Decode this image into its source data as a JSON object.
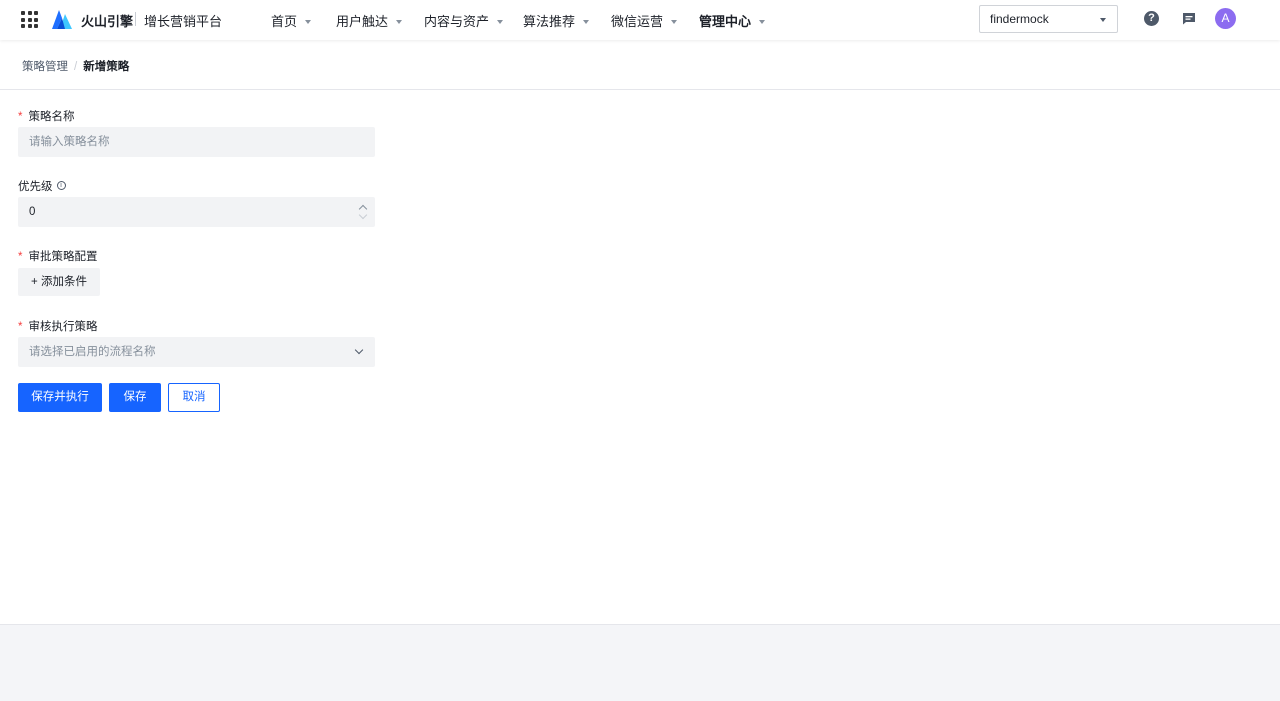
{
  "header": {
    "brand": "火山引擎",
    "platform": "增长营销平台",
    "nav": [
      {
        "label": "首页"
      },
      {
        "label": "用户触达"
      },
      {
        "label": "内容与资产"
      },
      {
        "label": "算法推荐"
      },
      {
        "label": "微信运营"
      },
      {
        "label": "管理中心"
      }
    ],
    "project": "findermock",
    "help_glyph": "?",
    "avatar_letter": "A"
  },
  "breadcrumb": {
    "parent": "策略管理",
    "separator": "/",
    "current": "新增策略"
  },
  "form": {
    "required_mark": "*",
    "name_label": "策略名称",
    "name_placeholder": "请输入策略名称",
    "priority_label": "优先级",
    "priority_value": "0",
    "info_glyph": "i",
    "approval_label": "审批策略配置",
    "add_condition": "+ 添加条件",
    "execution_label": "审核执行策略",
    "execution_placeholder": "请选择已启用的流程名称"
  },
  "actions": {
    "save_execute": "保存并执行",
    "save": "保存",
    "cancel": "取消"
  },
  "colors": {
    "primary": "#1664ff",
    "required": "#f53f3f",
    "avatar": "#8c6cf0"
  }
}
